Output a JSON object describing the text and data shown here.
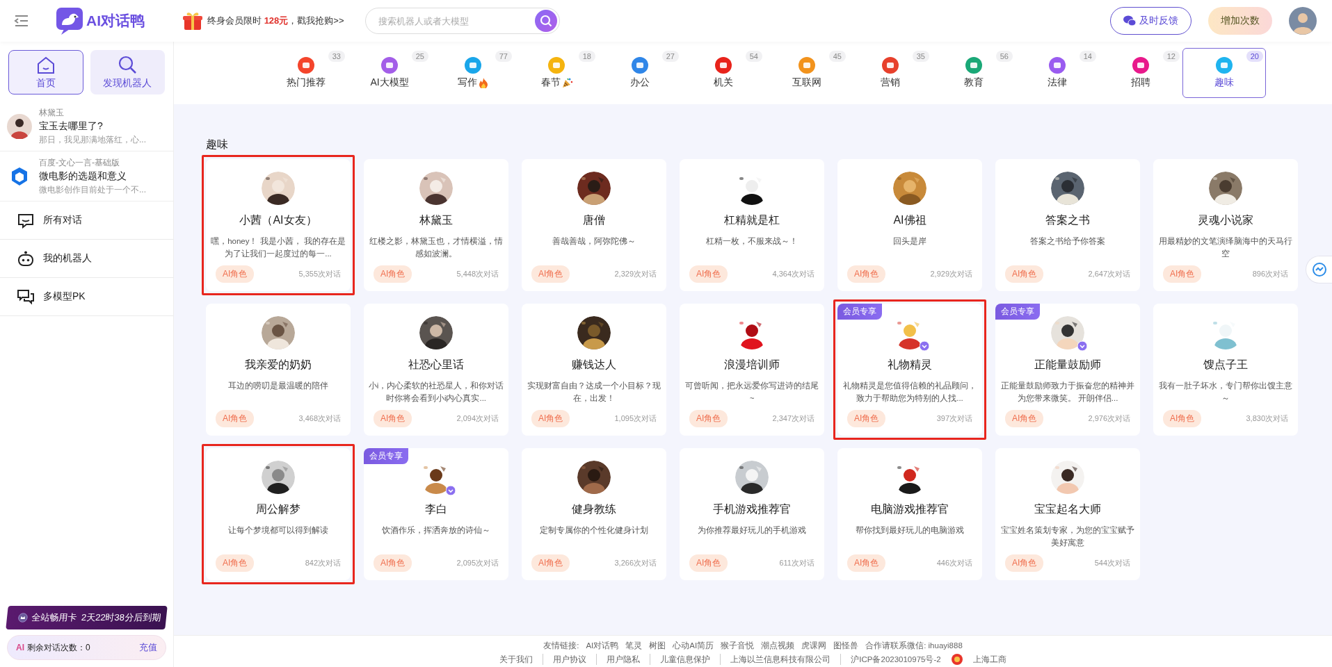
{
  "header": {
    "logo_text": "AI对话鸭",
    "promo": {
      "prefix": "终身会员限时 ",
      "price": "128元",
      "suffix": "，戳我抢购>>"
    },
    "search": {
      "placeholder": "搜索机器人或者大模型"
    },
    "feedback_button": "及时反馈",
    "add_button": "增加次数"
  },
  "sidebar": {
    "nav": [
      {
        "label": "首页",
        "kind": "home",
        "selected": true
      },
      {
        "label": "发现机器人",
        "kind": "discover",
        "selected": false
      }
    ],
    "recent": [
      {
        "bot": "林黛玉",
        "title": "宝玉去哪里了?",
        "preview": "那日，我见那满地落红，心...",
        "kind": "portrait"
      },
      {
        "bot": "百度-文心一言-基础版",
        "title": "微电影的选题和意义",
        "preview": "微电影创作目前处于一个不...",
        "kind": "cube"
      }
    ],
    "menu": [
      {
        "label": "所有对话",
        "kind": "chat"
      },
      {
        "label": "我的机器人",
        "kind": "robot"
      },
      {
        "label": "多模型PK",
        "kind": "compare"
      }
    ],
    "vip_card": {
      "label": "全站畅用卡",
      "expiry": "2天22时38分后到期"
    },
    "quota": {
      "badge": "AI",
      "label": "剩余对话次数：0",
      "link": "充值"
    }
  },
  "categories": [
    {
      "label": "热门推荐",
      "count": "33",
      "color": "#f4452c",
      "selected": false
    },
    {
      "label": "AI大模型",
      "count": "25",
      "color": "#a35ee8",
      "selected": false
    },
    {
      "label": "写作",
      "count": "77",
      "color": "#1aa6ea",
      "kind": "flame",
      "selected": false
    },
    {
      "label": "春节",
      "count": "18",
      "color": "#f5b40f",
      "kind": "popper",
      "selected": false
    },
    {
      "label": "办公",
      "count": "27",
      "color": "#2f86e8",
      "selected": false
    },
    {
      "label": "机关",
      "count": "54",
      "color": "#e8231b",
      "selected": false
    },
    {
      "label": "互联网",
      "count": "45",
      "color": "#f2931d",
      "selected": false
    },
    {
      "label": "营销",
      "count": "35",
      "color": "#e7402c",
      "selected": false
    },
    {
      "label": "教育",
      "count": "56",
      "color": "#1aa877",
      "selected": false
    },
    {
      "label": "法律",
      "count": "14",
      "color": "#9a5cf0",
      "selected": false
    },
    {
      "label": "招聘",
      "count": "12",
      "color": "#e8198b",
      "selected": false
    },
    {
      "label": "趣味",
      "count": "20",
      "color": "#1fb4ef",
      "selected": true
    }
  ],
  "section_title": "趣味",
  "cards": [
    {
      "name": "小茜（AI女友）",
      "desc": "嘿，honey！ 我是小茜， 我的存在是为了让我们一起度过的每一...",
      "tag": "AI角色",
      "count": "5,355次对话",
      "highlighted": true
    },
    {
      "name": "林黛玉",
      "desc": "红楼之影，林黛玉也，才情横溢，情感如波澜。",
      "tag": "AI角色",
      "count": "5,448次对话",
      "highlighted": false
    },
    {
      "name": "唐僧",
      "desc": "善哉善哉，阿弥陀佛～",
      "tag": "AI角色",
      "count": "2,329次对话",
      "highlighted": false
    },
    {
      "name": "杠精就是杠",
      "desc": "杠精一枚，不服来战～！",
      "tag": "AI角色",
      "count": "4,364次对话",
      "highlighted": false
    },
    {
      "name": "AI佛祖",
      "desc": "回头是岸",
      "tag": "AI角色",
      "count": "2,929次对话",
      "highlighted": false
    },
    {
      "name": "答案之书",
      "desc": "答案之书给予你答案",
      "tag": "AI角色",
      "count": "2,647次对话",
      "highlighted": false
    },
    {
      "name": "灵魂小说家",
      "desc": "用最精妙的文笔演绎脑海中的天马行空",
      "tag": "AI角色",
      "count": "896次对话",
      "highlighted": false
    },
    {
      "name": "我亲爱的奶奶",
      "desc": "耳边的唠叨是最温暖的陪伴",
      "tag": "AI角色",
      "count": "3,468次对话",
      "highlighted": false
    },
    {
      "name": "社恐心里话",
      "desc": "小i，内心柔软的社恐星人，和你对话时你将会看到小i内心真实...",
      "tag": "AI角色",
      "count": "2,094次对话",
      "highlighted": false
    },
    {
      "name": "赚钱达人",
      "desc": "实现财富自由？达成一个小目标？现在，出发！",
      "tag": "AI角色",
      "count": "1,095次对话",
      "highlighted": false
    },
    {
      "name": "浪漫培训师",
      "desc": "可曾听闻，把永远爱你写进诗的结尾~",
      "tag": "AI角色",
      "count": "2,347次对话",
      "highlighted": false
    },
    {
      "name": "礼物精灵",
      "desc": "礼物精灵是您值得信赖的礼品顾问，致力于帮助您为特别的人找...",
      "tag": "AI角色",
      "count": "397次对话",
      "member_badge": "会员专享",
      "highlighted": true
    },
    {
      "name": "正能量鼓励师",
      "desc": "正能量鼓励师致力于振奋您的精神并为您带来微笑。 开朗伴侣...",
      "tag": "AI角色",
      "count": "2,976次对话",
      "member_badge": "会员专享",
      "highlighted": false
    },
    {
      "name": "馊点子王",
      "desc": "我有一肚子坏水，专门帮你出馊主意～",
      "tag": "AI角色",
      "count": "3,830次对话",
      "highlighted": false
    },
    {
      "name": "周公解梦",
      "desc": "让每个梦境都可以得到解读",
      "tag": "AI角色",
      "count": "842次对话",
      "highlighted": true
    },
    {
      "name": "李白",
      "desc": "饮酒作乐，挥洒奔放的诗仙～",
      "tag": "AI角色",
      "count": "2,095次对话",
      "member_badge": "会员专享",
      "highlighted": false
    },
    {
      "name": "健身教练",
      "desc": "定制专属你的个性化健身计划",
      "tag": "AI角色",
      "count": "3,266次对话",
      "highlighted": false
    },
    {
      "name": "手机游戏推荐官",
      "desc": "为你推荐最好玩儿的手机游戏",
      "tag": "AI角色",
      "count": "611次对话",
      "highlighted": false
    },
    {
      "name": "电脑游戏推荐官",
      "desc": "帮你找到最好玩儿的电脑游戏",
      "tag": "AI角色",
      "count": "446次对话",
      "highlighted": false
    },
    {
      "name": "宝宝起名大师",
      "desc": "宝宝姓名策划专家，为您的宝宝赋予美好寓意",
      "tag": "AI角色",
      "count": "544次对话",
      "highlighted": false
    }
  ],
  "footer": {
    "links_label": "友情链接:",
    "links": [
      "AI对话鸭",
      "笔灵",
      "树图",
      "心动AI简历",
      "猴子音悦",
      "潮点视频",
      "虎课网",
      "图怪兽",
      "合作请联系微信: ihuayi888"
    ],
    "legal": [
      "关于我们",
      "用户协议",
      "用户隐私",
      "儿童信息保护",
      "上海以兰信息科技有限公司",
      "沪ICP备2023010975号-2",
      "上海工商"
    ]
  }
}
